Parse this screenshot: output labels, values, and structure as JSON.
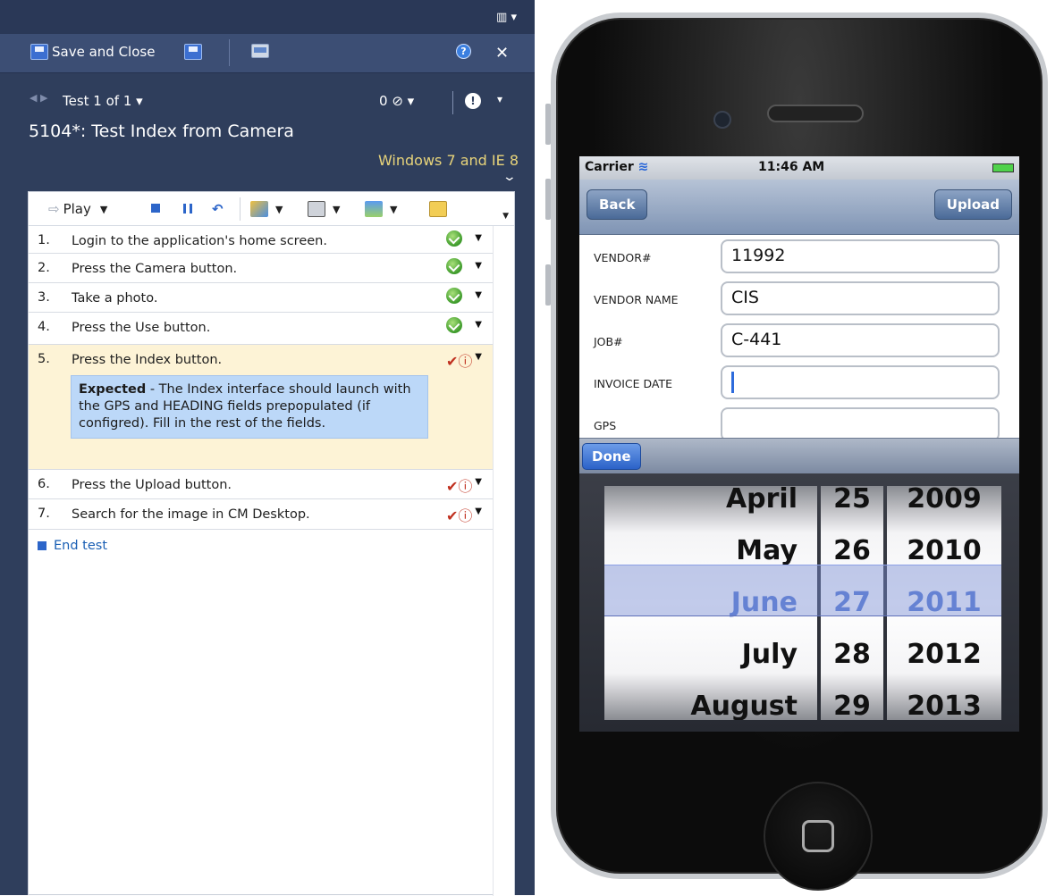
{
  "runner": {
    "toolbar": {
      "save_close_label": "Save and Close"
    },
    "nav": {
      "counter": "Test 1 of 1",
      "attachments": "0"
    },
    "title": "5104*: Test Index from Camera",
    "configuration": "Windows 7 and IE 8",
    "steps_toolbar": {
      "play_label": "Play"
    },
    "steps": [
      {
        "num": "1.",
        "text": "Login to the application's home screen.",
        "status": "passed"
      },
      {
        "num": "2.",
        "text": "Press the Camera button.",
        "status": "passed"
      },
      {
        "num": "3.",
        "text": "Take a photo.",
        "status": "passed"
      },
      {
        "num": "4.",
        "text": "Press the Use button.",
        "status": "passed"
      },
      {
        "num": "5.",
        "text": "Press the Index button.",
        "status": "pending"
      },
      {
        "num": "6.",
        "text": "Press the Upload button.",
        "status": "pending"
      },
      {
        "num": "7.",
        "text": "Search for the image in CM Desktop.",
        "status": "pending"
      }
    ],
    "expected": {
      "label": "Expected",
      "text": " - The Index interface should launch with the GPS and HEADING fields prepopulated (if configred). Fill in the rest of the fields."
    },
    "end_test": "End test"
  },
  "phone": {
    "status": {
      "carrier": "Carrier",
      "time": "11:46 AM"
    },
    "nav": {
      "back": "Back",
      "upload": "Upload"
    },
    "fields": [
      {
        "label": "VENDOR#",
        "value": "11992"
      },
      {
        "label": "VENDOR NAME",
        "value": "CIS"
      },
      {
        "label": "JOB#",
        "value": "C-441"
      },
      {
        "label": "INVOICE DATE",
        "value": ""
      },
      {
        "label": "GPS",
        "value": ""
      }
    ],
    "done": "Done",
    "picker": {
      "months": [
        "April",
        "May",
        "June",
        "July",
        "August"
      ],
      "days": [
        "25",
        "26",
        "27",
        "28",
        "29"
      ],
      "years": [
        "2009",
        "2010",
        "2011",
        "2012",
        "2013"
      ],
      "selected_month": "June",
      "selected_day": "27",
      "selected_year": "2011"
    }
  },
  "colors": {
    "runner_bg": "#2f3e5c",
    "config_text": "#e8d47a",
    "expected_bg": "#bcd8f8",
    "active_row_bg": "#fdf3d6",
    "picker_selected": "#3a63cc"
  }
}
